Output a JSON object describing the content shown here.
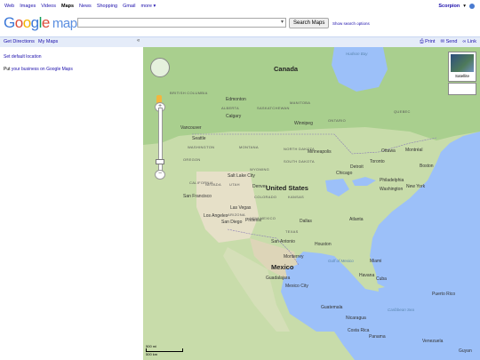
{
  "topnav": {
    "items": [
      "Web",
      "Images",
      "Videos",
      "Maps",
      "News",
      "Shopping",
      "Gmail",
      "more ▾"
    ],
    "selected": "Maps",
    "user": "Scorpion",
    "user_menu": "▾"
  },
  "logo": {
    "google": "Google",
    "maps": "maps"
  },
  "search": {
    "value": "",
    "button": "Search Maps",
    "options_link": "Show search options"
  },
  "panel": {
    "get_directions": "Get Directions",
    "my_maps": "My Maps",
    "collapse": "«",
    "print": "Print",
    "send": "Send",
    "link": "Link",
    "default_location": "Set default location",
    "business_prefix": "Put",
    "business_link": "your business on Google Maps"
  },
  "map": {
    "satellite_label": "Satellite",
    "scale_top": "500 mi",
    "scale_bottom": "500 km",
    "labels": {
      "canada": "Canada",
      "united_states": "United States",
      "mexico": "Mexico",
      "hudson_bay": "Hudson Bay",
      "gulf_of_mexico": "Gulf of Mexico",
      "caribbean_sea": "Caribbean Sea",
      "cuba": "Cuba",
      "guatemala": "Guatemala",
      "nicaragua": "Nicaragua",
      "venezuela": "Venezuela",
      "guyana": "Guyan",
      "puerto_rico": "Puerto Rico",
      "costa_rica": "Costa Rica",
      "panama": "Panama",
      "vancouver": "Vancouver",
      "seattle": "Seattle",
      "calgary": "Calgary",
      "edmonton": "Edmonton",
      "winnipeg": "Winnipeg",
      "chicago": "Chicago",
      "detroit": "Detroit",
      "toronto": "Toronto",
      "ottawa": "Ottawa",
      "montreal": "Montréal",
      "boston": "Boston",
      "new_york": "New York",
      "philadelphia": "Philadelphia",
      "washington": "Washington",
      "san_francisco": "San Francisco",
      "las_vegas": "Las Vegas",
      "los_angeles": "Los Angeles",
      "san_diego": "San Diego",
      "phoenix": "Phoenix",
      "dallas": "Dallas",
      "houston": "Houston",
      "san_antonio": "San Antonio",
      "monterrey": "Monterrey",
      "guadalajara": "Guadalajara",
      "mexico_city": "Mexico City",
      "havana": "Havana",
      "miami": "Miami",
      "atlanta": "Atlanta",
      "denver": "Denver",
      "salt_lake": "Salt Lake City",
      "minneapolis": "Minneapolis"
    },
    "states": {
      "british_columbia": "BRITISH COLUMBIA",
      "alberta": "ALBERTA",
      "saskatchewan": "SASKATCHEWAN",
      "manitoba": "MANITOBA",
      "ontario": "ONTARIO",
      "quebec": "QUEBEC",
      "washington_st": "WASHINGTON",
      "oregon": "OREGON",
      "montana": "MONTANA",
      "north_dakota": "NORTH DAKOTA",
      "south_dakota": "SOUTH DAKOTA",
      "wyoming": "WYOMING",
      "nevada": "NEVADA",
      "utah": "UTAH",
      "colorado": "COLORADO",
      "kansas": "KANSAS",
      "texas": "TEXAS",
      "new_mexico": "NEW MEXICO",
      "arizona": "ARIZONA",
      "california": "CALIFORNIA"
    }
  }
}
